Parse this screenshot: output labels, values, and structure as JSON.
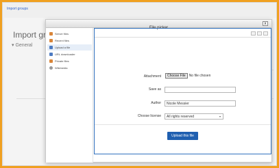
{
  "background": {
    "breadcrumb": "Import groups",
    "page_title": "Import gr",
    "section_label": "General",
    "section_chevron": "▾"
  },
  "modal": {
    "title": "File picker",
    "close_glyph": "x"
  },
  "sidebar": {
    "items": [
      {
        "label": "Server files",
        "icon": "server-icon",
        "color": "#d9863a"
      },
      {
        "label": "Recent files",
        "icon": "recent-icon",
        "color": "#d9863a"
      },
      {
        "label": "Upload a file",
        "icon": "upload-icon",
        "color": "#4d7bc2",
        "active": true
      },
      {
        "label": "URL downloader",
        "icon": "url-icon",
        "color": "#4d7bc2"
      },
      {
        "label": "Private files",
        "icon": "private-files-icon",
        "color": "#d9863a"
      },
      {
        "label": "Wikimedia",
        "icon": "wikimedia-icon",
        "color": "#999999"
      }
    ]
  },
  "form": {
    "attachment_label": "Attachment",
    "choose_button": "Choose File",
    "no_file_text": "No file chosen",
    "save_as_label": "Save as",
    "save_as_value": "",
    "author_label": "Author",
    "author_value": "Nicole Messier",
    "license_label": "Choose license",
    "license_value": "All rights reserved",
    "license_chevron": "▾",
    "upload_button": "Upload this file"
  },
  "colors": {
    "accent": "#1f5fb0",
    "frame": "#f0a020"
  }
}
